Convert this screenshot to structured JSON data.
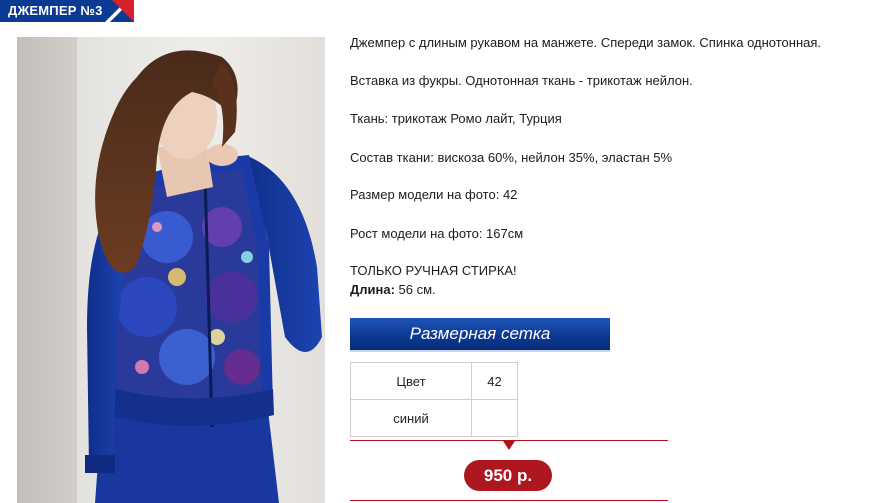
{
  "header": {
    "title": "ДЖЕМПЕР №3"
  },
  "product": {
    "description_lines": [
      "Джемпер с длиным рукавом на манжете. Спереди замок. Спинка однотонная.",
      "Вставка из фукры. Однотонная ткань - трикотаж нейлон.",
      "Ткань: трикотаж Ромо лайт, Турция",
      "Состав ткани: вискоза 60%, нейлон 35%, эластан 5%",
      "Размер модели на фото: 42",
      "Рост модели на фото: 167см",
      "ТОЛЬКО РУЧНАЯ СТИРКА!"
    ],
    "length_label": "Длина:",
    "length_value": " 56 см."
  },
  "size_grid": {
    "button_label": "Размерная сетка",
    "rows": [
      [
        "Цвет",
        "42"
      ],
      [
        "синий",
        ""
      ]
    ]
  },
  "price": {
    "label": "950 р."
  },
  "colors": {
    "brand_blue": "#0b3a94",
    "accent_red": "#ae1620"
  }
}
